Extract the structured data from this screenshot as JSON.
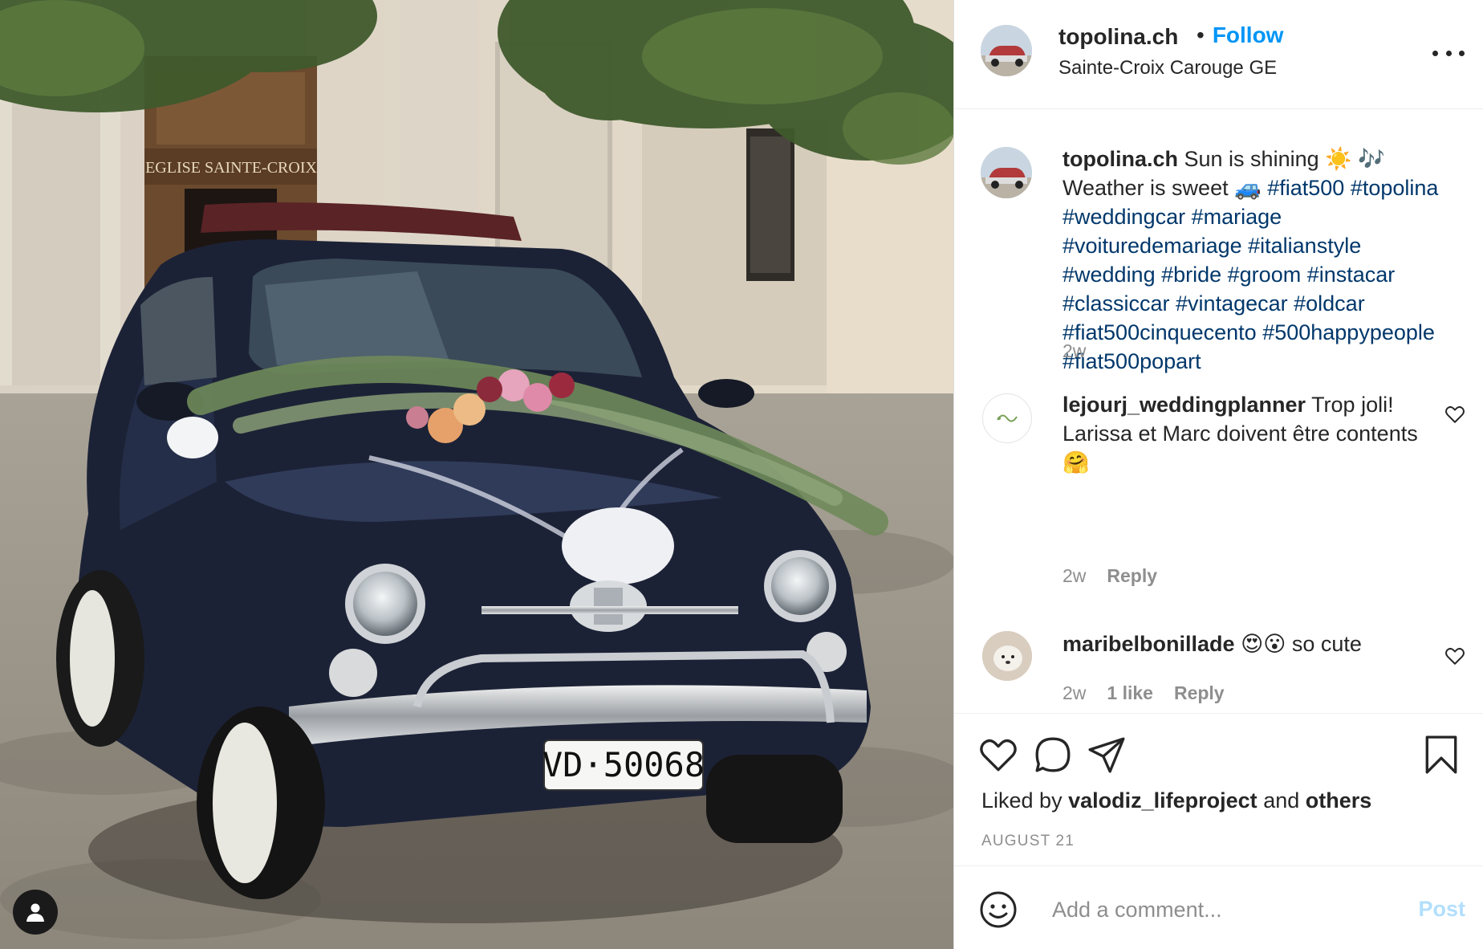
{
  "photo": {
    "church_sign": "EGLISE  SAINTE-CROIX",
    "plate": "VD·50068"
  },
  "header": {
    "username": "topolina.ch",
    "separator": "•",
    "follow_label": "Follow",
    "location": "Sainte-Croix Carouge GE"
  },
  "caption": {
    "username": "topolina.ch",
    "text": "Sun is shining ☀️ 🎶 Weather is sweet 🚙",
    "hashtags": "#fiat500 #topolina #weddingcar #mariage #voituredemariage #italianstyle #wedding #bride #groom #instacar #classiccar #vintagecar #oldcar #fiat500cinquecento #500happypeople #fiat500popart",
    "time": "2w"
  },
  "comments": [
    {
      "username": "lejourj_weddingplanner",
      "text": "Trop joli! Larissa et Marc doivent être contents 🤗",
      "time": "2w",
      "likes": "",
      "reply_label": "Reply"
    },
    {
      "username": "maribelbonillade",
      "text": "😍😮 so cute",
      "time": "2w",
      "likes": "1 like",
      "reply_label": "Reply"
    }
  ],
  "actions": {
    "liked_by_prefix": "Liked by",
    "liked_by_user": "valodiz_lifeproject",
    "liked_by_and": "and",
    "liked_by_others": "others",
    "date": "AUGUST 21"
  },
  "add_comment": {
    "placeholder": "Add a comment...",
    "post_label": "Post"
  },
  "colors": {
    "follow": "#0095f6",
    "hashtag": "#00376b",
    "post_disabled": "#b2dffc",
    "muted": "#8e8e8e"
  }
}
